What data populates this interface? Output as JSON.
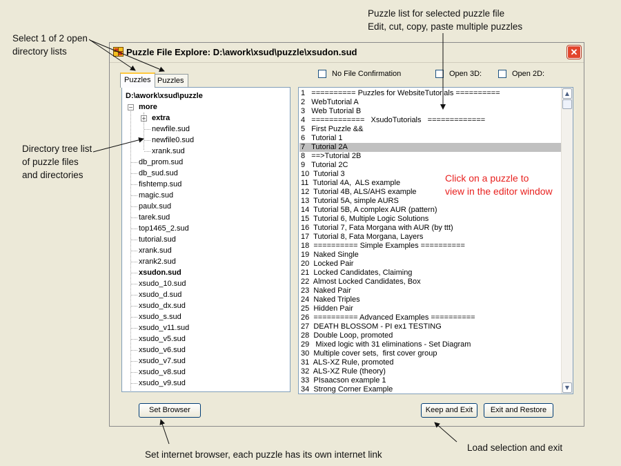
{
  "annotations": {
    "tabs_note": [
      "Select 1 of 2 open",
      "directory lists"
    ],
    "tree_note": [
      "Directory tree list",
      "of puzzle files",
      "and directories"
    ],
    "list_note": [
      "Puzzle list for selected puzzle file",
      "Edit, cut, copy, paste multiple puzzles"
    ],
    "click_note": [
      "Click on a puzzle to",
      "view in the editor window"
    ],
    "browser_note": "Set internet browser, each puzzle has its own internet link",
    "exit_note": "Load selection and exit"
  },
  "window": {
    "title": "Puzzle File Explore: D:\\awork\\xsud\\puzzle\\xsudon.sud",
    "close_label": "✕"
  },
  "tabs": [
    {
      "label": "Puzzles",
      "active": true
    },
    {
      "label": "Puzzles",
      "active": false
    }
  ],
  "options": {
    "no_file_confirmation": "No File Confirmation",
    "open_3d": "Open 3D:",
    "open_2d": "Open 2D:"
  },
  "tree": {
    "root": "D:\\awork\\xsud\\puzzle",
    "folder_more": "more",
    "folder_extra": "extra",
    "more_files": [
      "newfile.sud",
      "newfile0.sud",
      "xrank.sud"
    ],
    "files": [
      "db_prom.sud",
      "db_sud.sud",
      "fishtemp.sud",
      "magic.sud",
      "paulx.sud",
      "tarek.sud",
      "top1465_2.sud",
      "tutorial.sud",
      "xrank.sud",
      "xrank2.sud",
      "xsudon.sud",
      "xsudo_10.sud",
      "xsudo_d.sud",
      "xsudo_dx.sud",
      "xsudo_s.sud",
      "xsudo_v11.sud",
      "xsudo_v5.sud",
      "xsudo_v6.sud",
      "xsudo_v7.sud",
      "xsudo_v8.sud",
      "xsudo_v9.sud"
    ],
    "selected_file": "xsudon.sud"
  },
  "puzzle_list": {
    "selected_index": 7,
    "items": [
      "1   ========== Puzzles for WebsiteTutorials ==========",
      "2   WebTutorial A",
      "3   Web Tutorial B",
      "4   ============   XsudoTutorials   =============",
      "5   First Puzzle &&",
      "6   Tutorial 1",
      "7   Tutorial 2A",
      "8   ==>Tutorial 2B",
      "9   Tutorial 2C",
      "10  Tutorial 3",
      "11  Tutorial 4A,  ALS example",
      "12  Tutorial 4B, ALS/AHS example",
      "13  Tutorial 5A, simple AURS",
      "14  Tutorial 5B, A complex AUR (pattern)",
      "15  Tutorial 6, Multiple Logic Solutions",
      "16  Tutorial 7, Fata Morgana with AUR (by ttt)",
      "17  Tutorial 8, Fata Morgana, Layers",
      "18  ========== Simple Examples ==========",
      "19  Naked Single",
      "20  Locked Pair",
      "21  Locked Candidates, Claiming",
      "22  Almost Locked Candidates, Box",
      "23  Naked Pair",
      "24  Naked Triples",
      "25  Hidden Pair",
      "26  ========== Advanced Examples ==========",
      "27  DEATH BLOSSOM - PI ex1 TESTING",
      "28  Double Loop, promoted",
      "29   Mixed logic with 31 eliminations - Set Diagram",
      "30  Multiple cover sets,  first cover group",
      "31  ALS-XZ Rule, promoted",
      "32  ALS-XZ Rule (theory)",
      "33  PIsaacson example 1",
      "34  Strong Corner Example"
    ]
  },
  "buttons": {
    "set_browser": "Set Browser",
    "keep_and_exit": "Keep and Exit",
    "exit_and_restore": "Exit and Restore"
  },
  "icons": {
    "app": "puzzle-app-icon",
    "close": "close-icon",
    "expand_minus": "tree-collapse-icon",
    "expand_plus": "tree-expand-icon",
    "scroll_up": "scroll-up-icon",
    "scroll_down": "scroll-down-icon"
  }
}
